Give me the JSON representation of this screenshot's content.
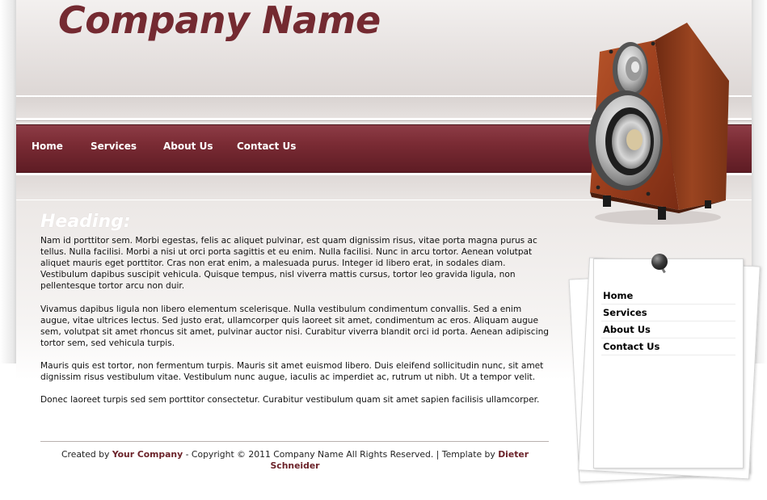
{
  "header": {
    "company_name": "Company Name"
  },
  "nav": {
    "items": [
      {
        "label": "Home"
      },
      {
        "label": "Services"
      },
      {
        "label": "About Us"
      },
      {
        "label": "Contact Us"
      }
    ]
  },
  "main": {
    "heading": "Heading:",
    "paragraphs": [
      "Nam id porttitor sem. Morbi egestas, felis ac aliquet pulvinar, est quam dignissim risus, vitae porta magna purus ac tellus. Nulla facilisi. Morbi a nisi ut orci porta sagittis et eu enim. Nulla facilisi. Nunc in arcu tortor. Aenean volutpat aliquet mauris eget porttitor. Cras non erat enim, a malesuada purus. Integer id libero erat, in sodales diam. Vestibulum dapibus suscipit vehicula. Quisque tempus, nisl viverra mattis cursus, tortor leo gravida ligula, non pellentesque tortor arcu non duir.",
      "Vivamus dapibus ligula non libero elementum scelerisque. Nulla vestibulum condimentum convallis. Sed a enim augue, vitae ultrices lectus. Sed justo erat, ullamcorper quis laoreet sit amet, condimentum ac eros. Aliquam augue sem, volutpat sit amet rhoncus sit amet, pulvinar auctor nisi. Curabitur viverra blandit orci id porta. Aenean adipiscing tortor sem, sed vehicula turpis.",
      "Mauris quis est tortor, non fermentum turpis. Mauris sit amet euismod libero. Duis eleifend sollicitudin nunc, sit amet dignissim risus vestibulum vitae. Vestibulum nunc augue, iaculis ac imperdiet ac, rutrum ut nibh. Ut a tempor velit.",
      "Donec laoreet turpis sed sem porttitor consectetur. Curabitur vestibulum quam sit amet sapien facilisis ullamcorper."
    ]
  },
  "footer": {
    "created_by": "Created by",
    "company_link": "Your Company",
    "copyright": "- Copyright © 2011 Company Name All Rights Reserved. | Template by",
    "author_link": "Dieter Schneider"
  },
  "sidebar": {
    "items": [
      {
        "label": "Home"
      },
      {
        "label": "Services"
      },
      {
        "label": "About Us"
      },
      {
        "label": "Contact Us"
      }
    ]
  },
  "colors": {
    "brand": "#742a31",
    "nav_bar": "#7a2b34",
    "background": "#e9e5e3"
  },
  "icons": [
    "speaker-image",
    "pushpin-icon"
  ]
}
